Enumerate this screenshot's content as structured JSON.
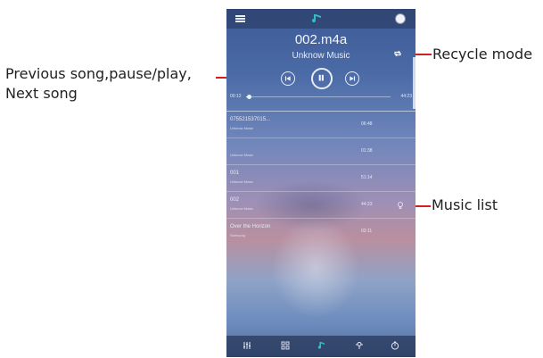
{
  "annotations": {
    "prev_next": "Previous song,pause/play,\nNext song",
    "recycle": "Recycle mode",
    "music_list": "Music list"
  },
  "player": {
    "song_title": "002.m4a",
    "artist": "Unknow Music",
    "time_elapsed": "00:12",
    "time_total": "44:23",
    "progress": 0.02
  },
  "tracks": [
    {
      "title": "075521537015...",
      "subtitle": "Unknow Music",
      "duration": "06:48"
    },
    {
      "title": "",
      "subtitle": "Unknow Music",
      "duration": "01:38"
    },
    {
      "title": "001",
      "subtitle": "Unknow Music",
      "duration": "51:14"
    },
    {
      "title": "002",
      "subtitle": "Unknow Music",
      "duration": "44:23"
    },
    {
      "title": "Over the Horizon",
      "subtitle": "Samsung",
      "duration": "03:11"
    }
  ],
  "icons": {
    "menu": "menu-icon",
    "logo": "app-logo-icon",
    "settings": "settings-icon",
    "recycle": "recycle-mode-icon",
    "prev": "previous-icon",
    "play_pause": "pause-icon",
    "next": "next-icon",
    "now_playing": "now-playing-icon",
    "bottom_nav": [
      "equalizer-icon",
      "grid-icon",
      "music-icon",
      "podcast-icon",
      "timer-icon"
    ]
  },
  "colors": {
    "annotation_line": "#d21f1f",
    "accent": "#29b6c8"
  }
}
